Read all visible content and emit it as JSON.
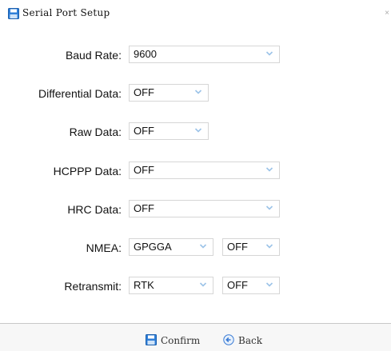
{
  "window": {
    "title": "Serial Port Setup"
  },
  "fields": {
    "baud_rate": {
      "label": "Baud Rate:",
      "value": "9600"
    },
    "differential_data": {
      "label": "Differential Data:",
      "value": "OFF"
    },
    "raw_data": {
      "label": "Raw Data:",
      "value": "OFF"
    },
    "hcppp_data": {
      "label": "HCPPP Data:",
      "value": "OFF"
    },
    "hrc_data": {
      "label": "HRC Data:",
      "value": "OFF"
    },
    "nmea": {
      "label": "NMEA:",
      "value": "GPGGA",
      "value2": "OFF"
    },
    "retransmit": {
      "label": "Retransmit:",
      "value": "RTK",
      "value2": "OFF"
    }
  },
  "footer": {
    "confirm_label": "Confirm",
    "back_label": "Back"
  },
  "colors": {
    "accent": "#3a7bd5",
    "arrow": "#9cc3e8",
    "border": "#d6d6d6"
  }
}
